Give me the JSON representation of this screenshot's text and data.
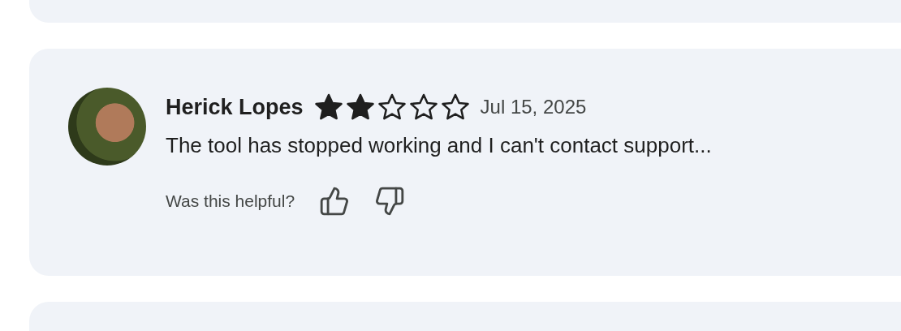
{
  "review": {
    "author": "Herick Lopes",
    "stars": 2,
    "date": "Jul 15, 2025",
    "text": "The tool has stopped working and I can't contact support...",
    "helpful_prompt": "Was this helpful?"
  }
}
